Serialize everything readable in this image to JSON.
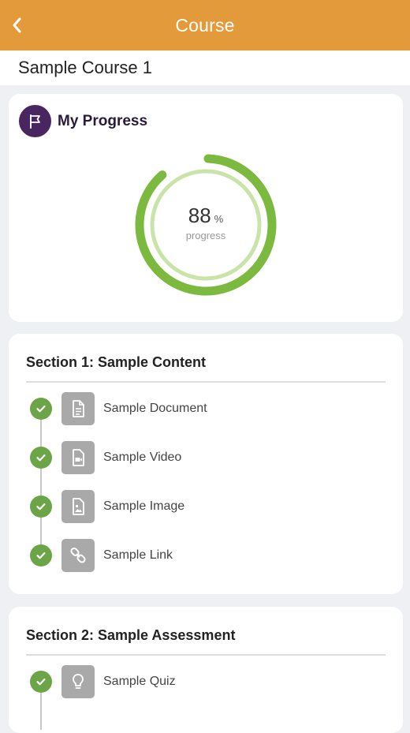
{
  "header": {
    "title": "Course",
    "back_icon": "chevron-left-icon"
  },
  "course": {
    "name": "Sample Course 1"
  },
  "progress": {
    "heading": "My Progress",
    "icon": "flag-icon",
    "value": 88,
    "unit": "%",
    "caption": "progress",
    "colors": {
      "accent": "#7cba3f",
      "track": "#c9e3a8",
      "avatar": "#4a2661"
    }
  },
  "sections": [
    {
      "title": "Section 1: Sample Content",
      "items": [
        {
          "label": "Sample Document",
          "icon": "document-icon",
          "completed": true
        },
        {
          "label": "Sample Video",
          "icon": "video-icon",
          "completed": true
        },
        {
          "label": "Sample Image",
          "icon": "image-icon",
          "completed": true
        },
        {
          "label": "Sample Link",
          "icon": "link-icon",
          "completed": true
        }
      ]
    },
    {
      "title": "Section 2: Sample Assessment",
      "items": [
        {
          "label": "Sample Quiz",
          "icon": "lightbulb-icon",
          "completed": true
        }
      ]
    }
  ],
  "theme": {
    "header_bg": "#e29a3a",
    "check_green": "#6ba547"
  }
}
